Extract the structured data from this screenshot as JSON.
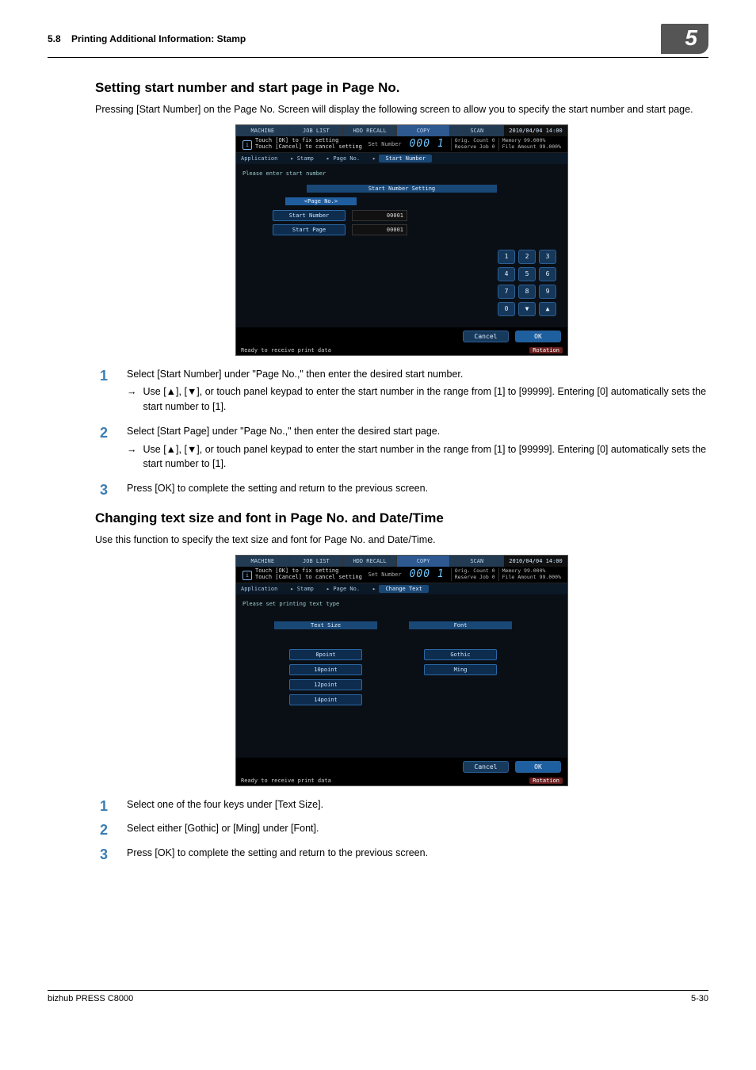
{
  "header": {
    "section_num": "5.8",
    "section_title": "Printing Additional Information: Stamp",
    "chapter": "5"
  },
  "section1": {
    "title": "Setting start number and start page in Page No.",
    "intro": "Pressing [Start Number] on the Page No. Screen will display the following screen to allow you to specify the start number and start page.",
    "screenshot": {
      "tabs": [
        "MACHINE",
        "JOB LIST",
        "HDD RECALL",
        "COPY",
        "SCAN"
      ],
      "timestamp": "2010/04/04 14:00",
      "info_line1": "Touch [OK] to fix setting",
      "info_line2": "Touch [Cancel] to cancel setting",
      "set_number_label": "Set Number",
      "set_number_value": "000 1",
      "stats_l1": "Orig. Count",
      "stats_l1v": "0",
      "stats_l2": "Reserve Job",
      "stats_l2v": "0",
      "stats_r1": "Memory",
      "stats_r1v": "99.000%",
      "stats_r2": "File Amount",
      "stats_r2v": "99.000%",
      "breadcrumb": [
        "Application",
        "Stamp",
        "Page No."
      ],
      "bc_current": "Start Number",
      "prompt": "Please enter start number",
      "group_label": "Start Number Setting",
      "sub_header": "<Page No.>",
      "rows": [
        {
          "label": "Start Number",
          "value": "00001"
        },
        {
          "label": "Start Page",
          "value": "00001"
        }
      ],
      "keypad": [
        "1",
        "2",
        "3",
        "4",
        "5",
        "6",
        "7",
        "8",
        "9",
        "0",
        "▼",
        "▲"
      ],
      "cancel": "Cancel",
      "ok": "OK",
      "ready": "Ready to receive print data",
      "rotation": "Rotation"
    },
    "steps": [
      {
        "main": "Select [Start Number] under \"Page No.,\" then enter the desired start number.",
        "sub": "Use [▲], [▼], or touch panel keypad to enter the start number in the range from [1] to [99999]. Entering [0] automatically sets the start number to [1]."
      },
      {
        "main": "Select [Start Page] under \"Page No.,\" then enter the desired start page.",
        "sub": "Use [▲], [▼], or touch panel keypad to enter the start number in the range from [1] to [99999]. Entering [0] automatically sets the start number to [1]."
      },
      {
        "main": "Press [OK] to complete the setting and return to the previous screen."
      }
    ]
  },
  "section2": {
    "title": "Changing text size and font in Page No. and Date/Time",
    "intro": "Use this function to specify the text size and font for Page No. and Date/Time.",
    "screenshot": {
      "tabs": [
        "MACHINE",
        "JOB LIST",
        "HDD RECALL",
        "COPY",
        "SCAN"
      ],
      "timestamp": "2010/04/04 14:00",
      "info_line1": "Touch [OK] to fix setting",
      "info_line2": "Touch [Cancel] to cancel setting",
      "set_number_label": "Set Number",
      "set_number_value": "000 1",
      "breadcrumb": [
        "Application",
        "Stamp",
        "Page No."
      ],
      "bc_current": "Change Text",
      "prompt": "Please set printing text type",
      "col1_hdr": "Text Size",
      "col2_hdr": "Font",
      "sizes": [
        "8point",
        "10point",
        "12point",
        "14point"
      ],
      "fonts": [
        "Gothic",
        "Ming"
      ],
      "cancel": "Cancel",
      "ok": "OK",
      "ready": "Ready to receive print data",
      "rotation": "Rotation"
    },
    "steps": [
      {
        "main": "Select one of the four keys under [Text Size]."
      },
      {
        "main": "Select either [Gothic] or [Ming] under [Font]."
      },
      {
        "main": "Press [OK] to complete the setting and return to the previous screen."
      }
    ]
  },
  "footer": {
    "product": "bizhub PRESS C8000",
    "page": "5-30"
  }
}
